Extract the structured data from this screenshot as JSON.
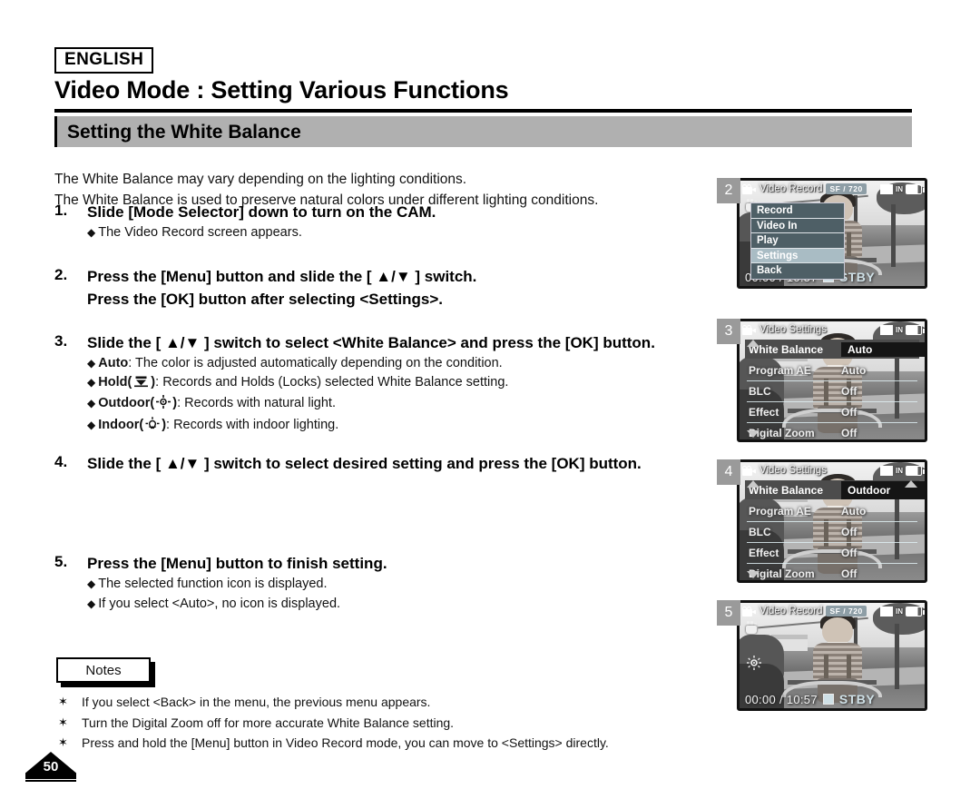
{
  "header": {
    "language": "ENGLISH",
    "title": "Video Mode : Setting Various Functions",
    "section": "Setting the White Balance"
  },
  "intro": {
    "line1": "The White Balance may vary depending on the lighting conditions.",
    "line2": "The White Balance is used to preserve natural colors under different lighting conditions."
  },
  "steps": [
    {
      "num": "1.",
      "head": "Slide [Mode Selector] down to turn on the CAM.",
      "subs": [
        "The Video Record screen appears."
      ]
    },
    {
      "num": "2.",
      "head": "Press the [Menu] button and slide the [ ▲/▼ ] switch.",
      "head2": "Press the [OK] button after selecting <Settings>.",
      "subs": []
    },
    {
      "num": "3.",
      "head": "Slide the [ ▲/▼ ] switch to select <White Balance> and press the [OK] button.",
      "subs": []
    },
    {
      "num": "4.",
      "head": "Slide the [ ▲/▼ ] switch to select desired setting and press the [OK] button.",
      "subs": []
    },
    {
      "num": "5.",
      "head": "Press the [Menu] button to finish setting.",
      "subs": [
        "The selected function icon is displayed.",
        "If you select <Auto>, no icon is displayed."
      ]
    }
  ],
  "wb_options": {
    "auto_name": "Auto",
    "auto_desc": ": The color is adjusted automatically depending on the condition.",
    "hold_name": "Hold",
    "hold_open": "(",
    "hold_close": ")",
    "hold_desc": ": Records and Holds (Locks) selected White Balance setting.",
    "outdoor_name": "Outdoor",
    "outdoor_open": "(",
    "outdoor_close": ")",
    "outdoor_desc": ": Records with natural light.",
    "indoor_name": "Indoor",
    "indoor_open": "(",
    "indoor_close": ")",
    "indoor_desc": ": Records with indoor lighting."
  },
  "notes": {
    "tab_label": "Notes",
    "items": [
      "If you select <Back> in the menu, the previous menu appears.",
      "Turn the Digital Zoom off for more accurate White Balance setting.",
      "Press and hold the [Menu] button in Video Record mode, you can move to <Settings> directly."
    ],
    "bullet": "✶"
  },
  "page_number": "50",
  "screens": [
    {
      "badge": "2",
      "osd_title": "Video Record",
      "quality": "SF",
      "separator": "/",
      "resolution": "720",
      "card_label": "IN",
      "time_elapsed": "00:00",
      "time_sep": "/",
      "time_total": "10:57",
      "status": "STBY",
      "menu": [
        {
          "label": "Record",
          "selected": false
        },
        {
          "label": "Video In",
          "selected": false
        },
        {
          "label": "Play",
          "selected": false
        },
        {
          "label": "Settings",
          "selected": true
        },
        {
          "label": "Back",
          "selected": false
        }
      ]
    },
    {
      "badge": "3",
      "osd_title": "Video Settings",
      "card_label": "IN",
      "rows": [
        {
          "label": "White Balance",
          "value": "Auto",
          "highlight": true,
          "icon": ""
        },
        {
          "label": "Program AE",
          "value": "Auto",
          "highlight": false,
          "icon": ""
        },
        {
          "label": "BLC",
          "value": "Off",
          "highlight": false,
          "icon": ""
        },
        {
          "label": "Effect",
          "value": "Off",
          "highlight": false,
          "icon": ""
        },
        {
          "label": "Digital Zoom",
          "value": "Off",
          "highlight": false,
          "icon": ""
        }
      ]
    },
    {
      "badge": "4",
      "osd_title": "Video Settings",
      "card_label": "IN",
      "rows": [
        {
          "label": "White Balance",
          "value": "Outdoor",
          "highlight": true,
          "icon": "sun-icon"
        },
        {
          "label": "Program AE",
          "value": "Auto",
          "highlight": false,
          "icon": ""
        },
        {
          "label": "BLC",
          "value": "Off",
          "highlight": false,
          "icon": ""
        },
        {
          "label": "Effect",
          "value": "Off",
          "highlight": false,
          "icon": ""
        },
        {
          "label": "Digital Zoom",
          "value": "Off",
          "highlight": false,
          "icon": ""
        }
      ]
    },
    {
      "badge": "5",
      "osd_title": "Video Record",
      "quality": "SF",
      "separator": "/",
      "resolution": "720",
      "card_label": "IN",
      "time_elapsed": "00:00",
      "time_sep": "/",
      "time_total": "10:57",
      "status": "STBY"
    }
  ],
  "colors": {
    "section_bar": "#b0b0b0",
    "badge_gray": "#9a9a9a",
    "menu_item": "#4e5f66",
    "menu_selected": "#a9bcc4",
    "osd_pill": "#8e9ea6",
    "stby": "#cfe0e6"
  }
}
